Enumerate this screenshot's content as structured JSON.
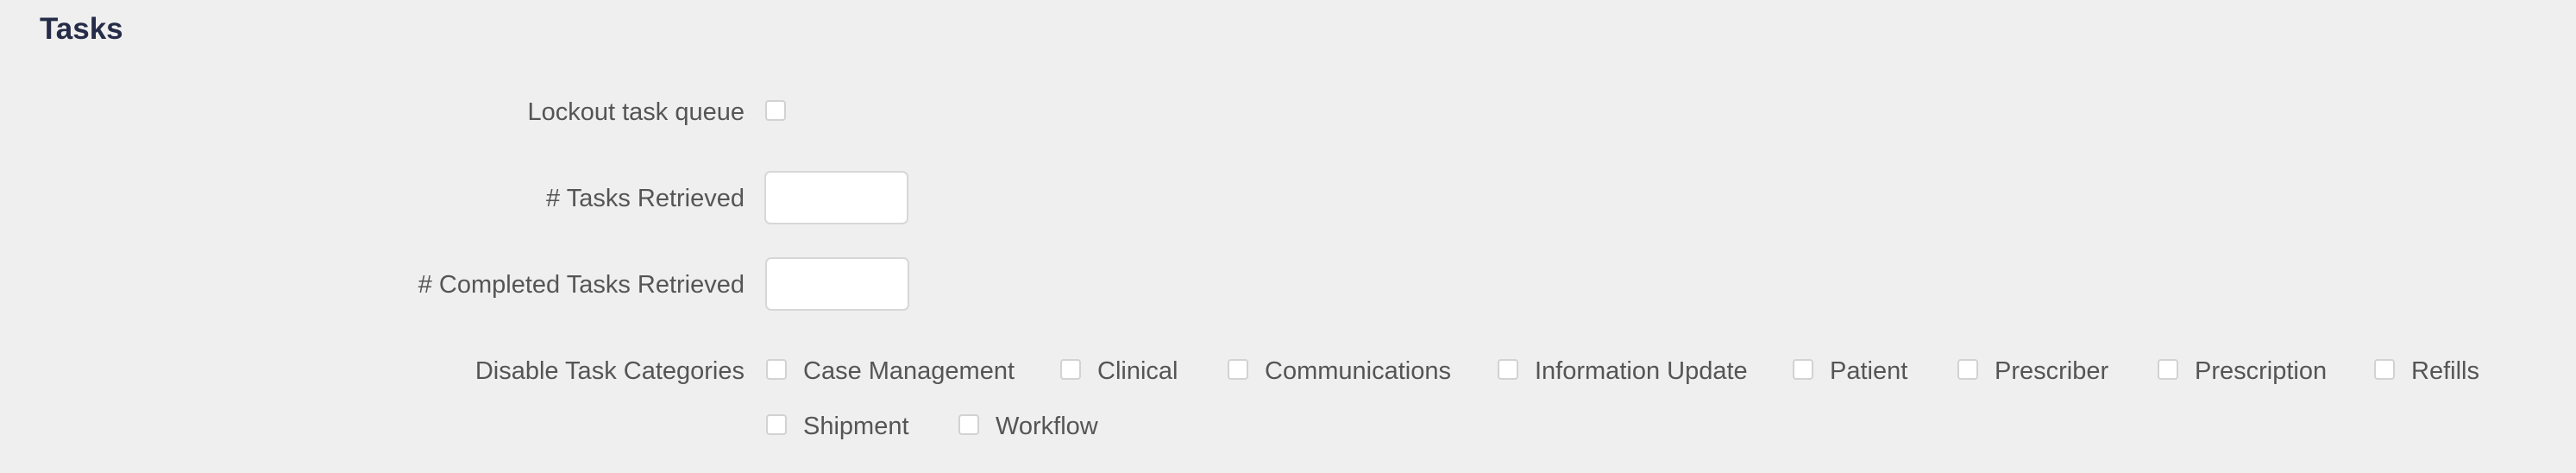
{
  "section": {
    "title": "Tasks"
  },
  "fields": {
    "lockout_label": "Lockout task queue",
    "tasks_retrieved_label": "# Tasks Retrieved",
    "tasks_retrieved_value": "",
    "completed_retrieved_label": "# Completed Tasks Retrieved",
    "completed_retrieved_value": "",
    "disable_categories_label": "Disable Task Categories"
  },
  "categories": [
    {
      "label": "Case Management",
      "checked": false
    },
    {
      "label": "Clinical",
      "checked": false
    },
    {
      "label": "Communications",
      "checked": false
    },
    {
      "label": "Information Update",
      "checked": false
    },
    {
      "label": "Patient",
      "checked": false
    },
    {
      "label": "Prescriber",
      "checked": false
    },
    {
      "label": "Prescription",
      "checked": false
    },
    {
      "label": "Refills",
      "checked": false
    },
    {
      "label": "Shipment",
      "checked": false
    },
    {
      "label": "Workflow",
      "checked": false
    }
  ]
}
